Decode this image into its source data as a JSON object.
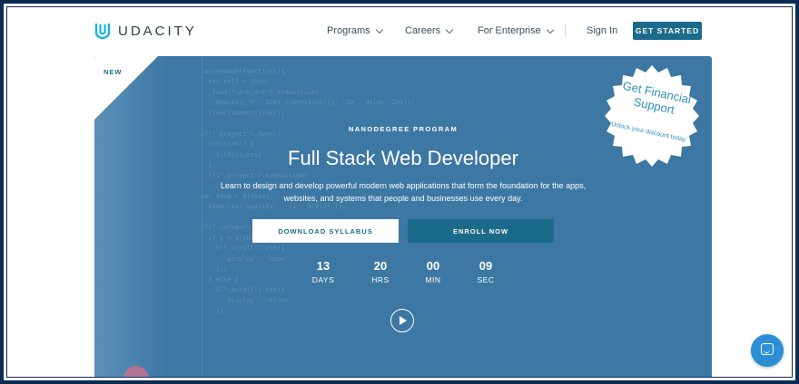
{
  "header": {
    "logo_text": "UDACITY",
    "nav": [
      {
        "label": "Programs"
      },
      {
        "label": "Careers"
      },
      {
        "label": "For Enterprise"
      }
    ],
    "signin_label": "Sign In",
    "cta_label": "GET STARTED"
  },
  "hero": {
    "corner_label": "NEW",
    "badge": {
      "title": "Get Financial Support",
      "subtitle": "Unlock your discount today"
    },
    "eyebrow": "NANODEGREE PROGRAM",
    "title": "Full Stack Web Developer",
    "description": "Learn to design and develop powerful modern web applications that form the foundation for the apps, websites, and systems that people and businesses use every day.",
    "download_label": "DOWNLOAD SYLLABUS",
    "enroll_label": "ENROLL NOW",
    "countdown": [
      {
        "value": "13",
        "unit": "DAYS"
      },
      {
        "value": "20",
        "unit": "HRS"
      },
      {
        "value": "00",
        "unit": "MIN"
      },
      {
        "value": "09",
        "unit": "SEC"
      }
    ]
  },
  "colors": {
    "brand": "#1b6a8c",
    "hero_bg": "#3d77a3",
    "badge_text": "#2f8fbf",
    "chat": "#2c8fd6"
  },
  "icons": {
    "logo": "udacity-logo-icon",
    "play": "play-icon",
    "chat": "chat-bubble-icon",
    "nav_chevron": "chevron-down-icon"
  }
}
